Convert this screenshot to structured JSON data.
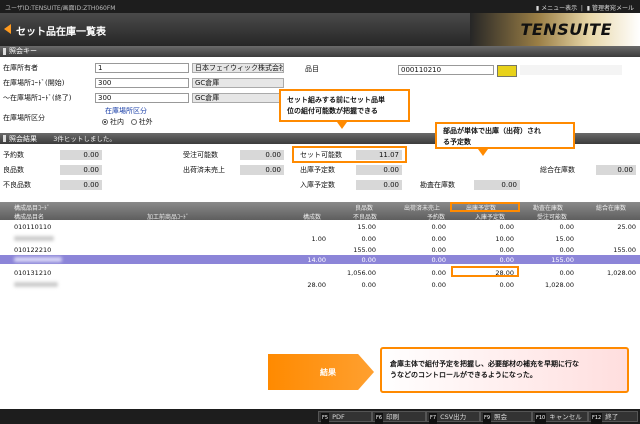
{
  "topbar": {
    "user": "ユーザID:TENSUITE/画面ID:ZTH060FM",
    "menu": "メニュー表示",
    "mail": "管理者宛メール"
  },
  "title": "セット品在庫一覧表",
  "logo": "TENSUITE",
  "search_section": {
    "title": "照会キー",
    "owner_label": "在庫所有者",
    "owner_code": "1",
    "owner_name": "日本フェイウィック株式会社",
    "loc_from_label": "在庫場所ｺｰﾄﾞ(開始)",
    "loc_from_code": "300",
    "loc_from_name": "GC倉庫",
    "loc_to_label": "〜在庫場所ｺｰﾄﾞ(終了)",
    "loc_to_code": "300",
    "loc_to_name": "GC倉庫",
    "loc_type_label": "在庫場所区分",
    "loc_type_title": "在庫場所区分",
    "radio_in": "社内",
    "radio_out": "社外",
    "item_label": "品目",
    "item_code": "000110210"
  },
  "callouts": {
    "set_line1": "セット組みする前にセット品単",
    "set_line2": "位の組付可能数が把握できる",
    "parts_line1": "部品が単体で出庫（出荷）され",
    "parts_line2": "る予定数"
  },
  "result_section": {
    "title": "照会結果",
    "hits": "3件ヒットしました。"
  },
  "summary": {
    "yoyaku_label": "予約数",
    "yoyaku": "0.00",
    "ryohin_label": "良品数",
    "ryohin": "0.00",
    "furyo_label": "不良品数",
    "furyo": "0.00",
    "juchu_label": "受注可能数",
    "juchu": "0.00",
    "shukka_label": "出荷済未売上",
    "shukka": "0.00",
    "set_label": "セット可能数",
    "set": "11.07",
    "shuko_label": "出庫予定数",
    "shuko": "0.00",
    "nyuko_label": "入庫予定数",
    "nyuko": "0.00",
    "kando_label": "勘査在庫数",
    "kando": "0.00",
    "sogo_label": "総合在庫数",
    "sogo": "0.00"
  },
  "grid": {
    "h1": [
      "構成品目ｺｰﾄﾞ",
      "良品数",
      "出荷済未売上",
      "出庫予定数",
      "勘査在庫数",
      "総合在庫数"
    ],
    "h2": [
      "構成品目名",
      "加工前商品ｺｰﾄﾞ",
      "構成数",
      "不良品数",
      "予約数",
      "入庫予定数",
      "受注可能数"
    ],
    "rows": [
      {
        "code": "010110110",
        "sub": "",
        "kousei": "1.00",
        "ryohin": "15.00",
        "furyo": "0.00",
        "shukka": "0.00",
        "yoyaku": "0.00",
        "shuko": "0.00",
        "nyuko": "10.00",
        "kando": "0.00",
        "juchu": "15.00",
        "sogo": "25.00"
      },
      {
        "code": "010122210",
        "sub": "",
        "kousei": "",
        "ryohin": "155.00",
        "furyo": "",
        "shukka": "0.00",
        "yoyaku": "",
        "shuko": "0.00",
        "nyuko": "",
        "kando": "0.00",
        "juchu": "",
        "sogo": "155.00"
      },
      {
        "code": "",
        "sub": "",
        "kousei": "14.00",
        "ryohin": "",
        "furyo": "0.00",
        "shukka": "",
        "yoyaku": "0.00",
        "shuko": "",
        "nyuko": "0.00",
        "kando": "",
        "juchu": "155.00",
        "sogo": ""
      },
      {
        "code": "010131210",
        "sub": "",
        "kousei": "28.00",
        "ryohin": "1,056.00",
        "furyo": "0.00",
        "shukka": "0.00",
        "yoyaku": "0.00",
        "shuko": "28.00",
        "nyuko": "0.00",
        "kando": "0.00",
        "juchu": "1,028.00",
        "sogo": "1,028.00"
      }
    ]
  },
  "result_banner": {
    "label": "結果",
    "line1": "倉庫主体で組付予定を把握し、必要部材の補充を早期に行な",
    "line2": "うなどのコントロールができるようになった。"
  },
  "fkeys": [
    {
      "key": "F5",
      "label": "PDF"
    },
    {
      "key": "F6",
      "label": "印刷"
    },
    {
      "key": "F7",
      "label": "CSV出力"
    },
    {
      "key": "F9",
      "label": "照会"
    },
    {
      "key": "F10",
      "label": "キャンセル"
    },
    {
      "key": "F12",
      "label": "終了"
    }
  ],
  "colors": {
    "accent": "#ff8a00",
    "highlight_row": "#8c85d8",
    "header_dark": "#3b3b3b"
  }
}
